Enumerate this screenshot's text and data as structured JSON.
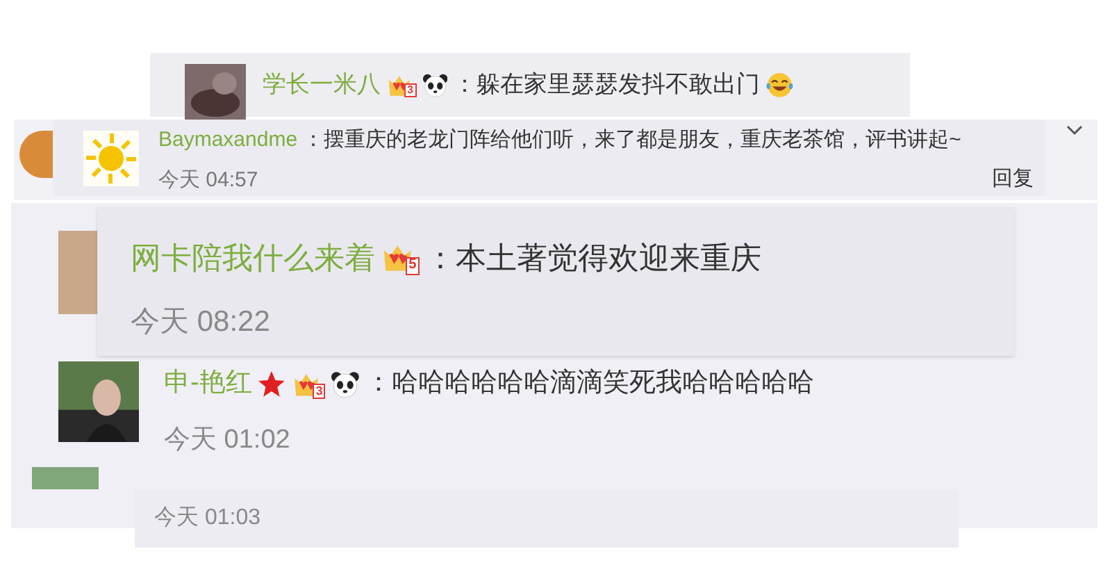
{
  "comments": [
    {
      "name": "学长一米八",
      "badges": [
        {
          "kind": "crown",
          "label": "3"
        },
        {
          "kind": "panda"
        }
      ],
      "text": "：躲在家里瑟瑟发抖不敢出门",
      "emoji_end": true,
      "avatar": {
        "kind": "picture"
      }
    },
    {
      "name": "Baymaxandme",
      "text": "：摆重庆的老龙门阵给他们听，来了都是朋友，重庆老茶馆，评书讲起~",
      "time": "今天 04:57",
      "reply": "回复",
      "avatar": {
        "kind": "picture"
      }
    },
    {
      "name": "网卡陪我什么来着",
      "badges": [
        {
          "kind": "crown",
          "label": "5"
        }
      ],
      "text": "：本土著觉得欢迎来重庆",
      "time": "今天 08:22"
    },
    {
      "name": "申-艳红",
      "badges": [
        {
          "kind": "star"
        },
        {
          "kind": "crown",
          "label": "3"
        },
        {
          "kind": "panda"
        }
      ],
      "text": "：哈哈哈哈哈哈滴滴笑死我哈哈哈哈哈",
      "time": "今天 01:02",
      "avatar": {
        "kind": "picture"
      }
    },
    {
      "time": "今天 01:03"
    }
  ]
}
